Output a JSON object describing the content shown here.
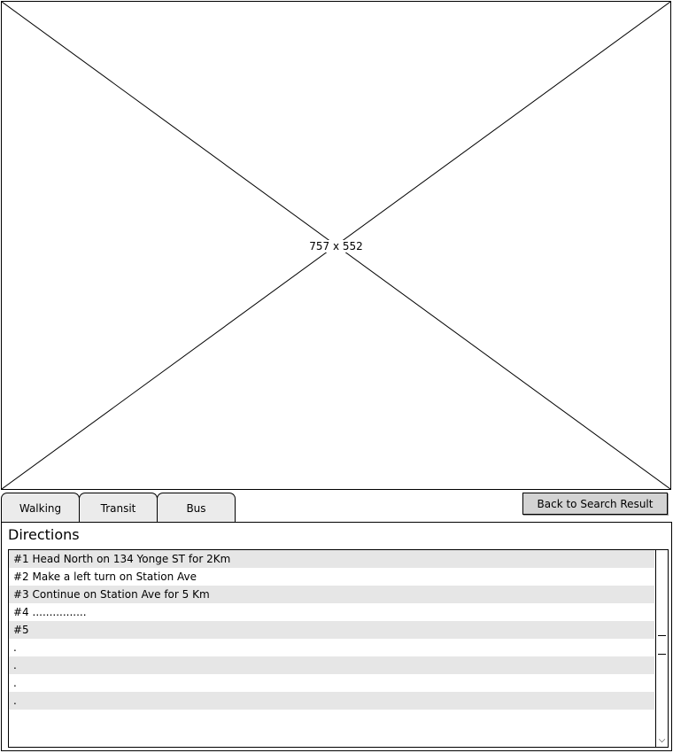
{
  "map": {
    "placeholder_label": "757 x 552"
  },
  "tabs": [
    {
      "label": "Walking"
    },
    {
      "label": "Transit"
    },
    {
      "label": "Bus"
    }
  ],
  "back_button": {
    "label": "Back to Search Result"
  },
  "directions": {
    "title": "Directions",
    "rows": [
      "#1 Head North on 134 Yonge ST for 2Km",
      "#2 Make a left turn on Station Ave",
      "#3 Continue on Station Ave for 5 Km",
      "#4 ................",
      "#5",
      ".",
      ".",
      ".",
      ".",
      ""
    ]
  },
  "scrollbar": {
    "down_arrow_glyph": "⌵"
  },
  "colors": {
    "row_shade": "#e6e6e6",
    "button_bg": "#d3d3d3",
    "tab_bg": "#ebebeb"
  }
}
